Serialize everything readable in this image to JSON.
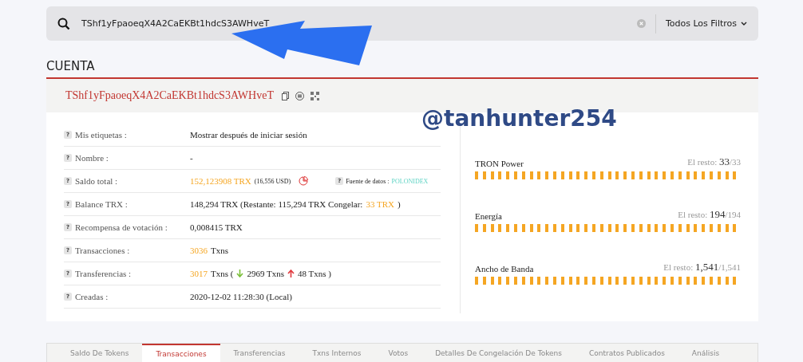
{
  "search": {
    "value": "TShf1yFpaoeqX4A2CaEKBt1hdcS3AWHveT",
    "filter": "Todos Los Filtros"
  },
  "section_title": "CUENTA",
  "account": {
    "address": "TShf1yFpaoeqX4A2CaEKBt1hdcS3AWHveT"
  },
  "details": [
    {
      "help": "?",
      "label": "Mis etiquetas :",
      "value": [
        {
          "kind": "text",
          "text": "Mostrar después de iniciar sesión"
        }
      ]
    },
    {
      "help": "?",
      "label": "Nombre :",
      "value": [
        {
          "kind": "text",
          "text": "-"
        }
      ]
    },
    {
      "help": "?",
      "label": "Saldo total  :",
      "value": [
        {
          "kind": "orange",
          "text": "152,123908 TRX"
        },
        {
          "kind": "small",
          "text": "(16,556 USD)"
        },
        {
          "kind": "pie"
        },
        {
          "kind": "source",
          "help": "?",
          "text": "Fuente de datos :",
          "link": "POLONIDEX"
        }
      ]
    },
    {
      "help": "?",
      "label": "Balance TRX  :",
      "value": [
        {
          "kind": "text",
          "text": "148,294 TRX (Restante: 115,294 TRX  Congelar:"
        },
        {
          "kind": "orange",
          "text": "33 TRX"
        },
        {
          "kind": "text",
          "text": ")"
        }
      ]
    },
    {
      "help": "?",
      "label": "Recompensa de votación  :",
      "value": [
        {
          "kind": "text",
          "text": "0,008415 TRX"
        }
      ]
    },
    {
      "help": "?",
      "label": "Transacciones  :",
      "value": [
        {
          "kind": "orange",
          "text": "3036"
        },
        {
          "kind": "text",
          "text": "Txns"
        }
      ]
    },
    {
      "help": "?",
      "label": "Transferencias  :",
      "value": [
        {
          "kind": "orange",
          "text": "3017"
        },
        {
          "kind": "text",
          "text": "Txns ("
        },
        {
          "kind": "down"
        },
        {
          "kind": "text",
          "text": "2969 Txns"
        },
        {
          "kind": "up"
        },
        {
          "kind": "text",
          "text": "48 Txns )"
        }
      ]
    },
    {
      "help": "?",
      "label": "Creadas  :",
      "value": [
        {
          "kind": "text",
          "text": "2020-12-02 11:28:30 (Local)"
        }
      ]
    }
  ],
  "resources": [
    {
      "name": "TRON Power",
      "caption": "El resto:",
      "remaining": "33",
      "total": "/33",
      "level": 1
    },
    {
      "name": "Energía",
      "caption": "El resto:",
      "remaining": "194",
      "total": "/194",
      "level": 1
    },
    {
      "name": "Ancho de Banda",
      "caption": "El resto:",
      "remaining": "1,541",
      "total": "/1,541",
      "level": 1
    }
  ],
  "tabs": [
    {
      "label": "Saldo De Tokens",
      "selected": false
    },
    {
      "label": "Transacciones",
      "selected": true
    },
    {
      "label": "Transferencias",
      "selected": false
    },
    {
      "label": "Txns Internos",
      "selected": false
    },
    {
      "label": "Votos",
      "selected": false
    },
    {
      "label": "Detalles De Congelación De Tokens",
      "selected": false
    },
    {
      "label": "Contratos Publicados",
      "selected": false
    },
    {
      "label": "Análisis",
      "selected": false
    }
  ],
  "overlay": {
    "handle": "@tanhunter254"
  }
}
